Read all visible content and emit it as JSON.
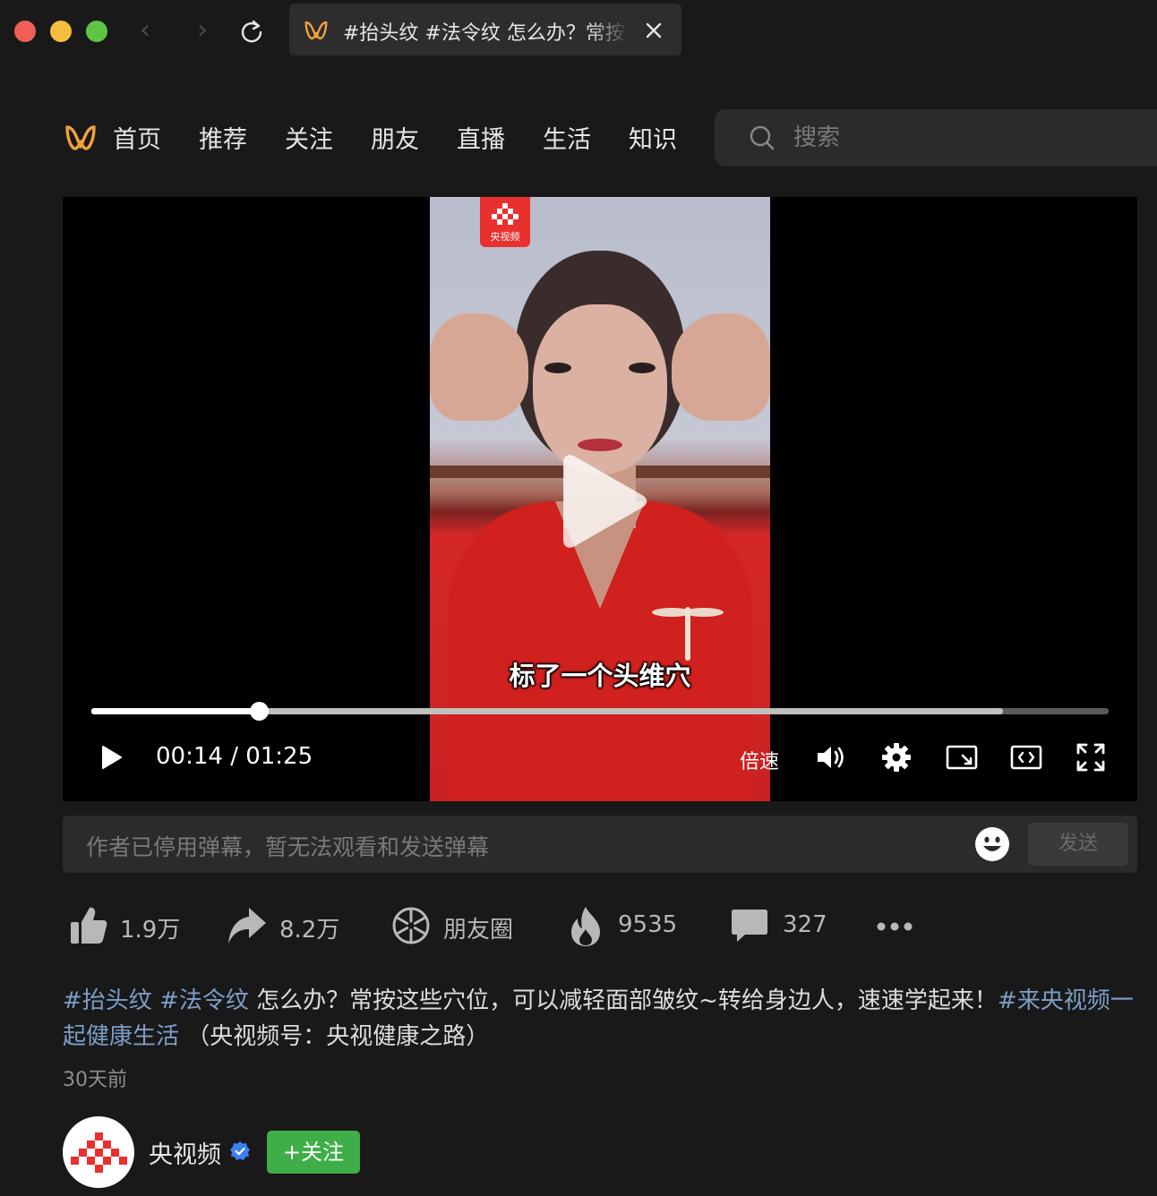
{
  "browser": {
    "tab_title": "#抬头纹 #法令纹 怎么办？常按这些穴位",
    "tab_close_icon": "close-icon",
    "reload_icon": "reload-icon"
  },
  "nav": {
    "logo": "channels-logo",
    "items": [
      {
        "label": "首页"
      },
      {
        "label": "推荐"
      },
      {
        "label": "关注"
      },
      {
        "label": "朋友"
      },
      {
        "label": "直播"
      },
      {
        "label": "生活"
      },
      {
        "label": "知识"
      }
    ],
    "search_placeholder": "搜索"
  },
  "video": {
    "watermark": "央视频",
    "subtitle": "标了一个头维穴",
    "progress": {
      "played": 0.165,
      "buffered": 0.896
    },
    "time": "00:14 / 01:25",
    "speed_label": "倍速",
    "state": "paused"
  },
  "danmu": {
    "placeholder": "作者已停用弹幕，暂无法观看和发送弹幕",
    "send_label": "发送"
  },
  "actions": {
    "likes": "1.9万",
    "shares": "8.2万",
    "moments": "朋友圈",
    "hot": "9535",
    "comments": "327"
  },
  "description": {
    "tag1": "#抬头纹",
    "tag2": "#法令纹",
    "text": " 怎么办？常按这些穴位，可以减轻面部皱纹~转给身边人，速速学起来！",
    "tag3": "#来央视频一起健康生活",
    "suffix": " （央视频号：央视健康之路）",
    "time": "30天前"
  },
  "author": {
    "name": "央视频",
    "follow_label": "+关注"
  },
  "colors": {
    "accent_orange": "#f2a03d",
    "follow_green": "#3fae48",
    "hashtag_blue": "#7c9ec7",
    "verified_blue": "#3d7ff5",
    "cctv_red": "#e8302e"
  }
}
